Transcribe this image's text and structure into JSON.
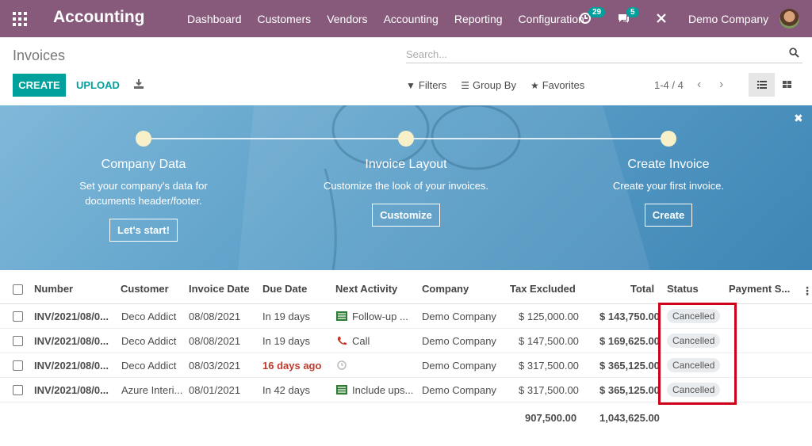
{
  "app": {
    "title": "Accounting"
  },
  "nav": [
    "Dashboard",
    "Customers",
    "Vendors",
    "Accounting",
    "Reporting",
    "Configuration"
  ],
  "systray": {
    "activity_count": "29",
    "messages_count": "5",
    "company": "Demo Company"
  },
  "page": {
    "title": "Invoices"
  },
  "search": {
    "placeholder": "Search..."
  },
  "buttons": {
    "create": "CREATE",
    "upload": "UPLOAD"
  },
  "filters": {
    "filters": "Filters",
    "group_by": "Group By",
    "favorites": "Favorites"
  },
  "pager": {
    "value": "1-4 / 4"
  },
  "banner": {
    "steps": [
      {
        "title": "Company Data",
        "desc1": "Set your company's data for",
        "desc2": "documents header/footer.",
        "button": "Let's start!"
      },
      {
        "title": "Invoice Layout",
        "desc1": "Customize the look of your invoices.",
        "desc2": "",
        "button": "Customize"
      },
      {
        "title": "Create Invoice",
        "desc1": "Create your first invoice.",
        "desc2": "",
        "button": "Create"
      }
    ]
  },
  "table": {
    "columns": [
      "Number",
      "Customer",
      "Invoice Date",
      "Due Date",
      "Next Activity",
      "Company",
      "Tax Excluded",
      "Total",
      "Status",
      "Payment S..."
    ],
    "rows": [
      {
        "number": "INV/2021/08/0...",
        "customer": "Deco Addict",
        "invoice_date": "08/08/2021",
        "due_date": "In 19 days",
        "activity_icon": "list-icon",
        "activity": "Follow-up ...",
        "company": "Demo Company",
        "tax_excluded": "$ 125,000.00",
        "total": "$ 143,750.00",
        "status": "Cancelled"
      },
      {
        "number": "INV/2021/08/0...",
        "customer": "Deco Addict",
        "invoice_date": "08/08/2021",
        "due_date": "In 19 days",
        "activity_icon": "phone-icon",
        "activity": "Call",
        "company": "Demo Company",
        "tax_excluded": "$ 147,500.00",
        "total": "$ 169,625.00",
        "status": "Cancelled"
      },
      {
        "number": "INV/2021/08/0...",
        "customer": "Deco Addict",
        "invoice_date": "08/03/2021",
        "due_date": "16 days ago",
        "activity_icon": "clock-icon",
        "activity": "",
        "company": "Demo Company",
        "tax_excluded": "$ 317,500.00",
        "total": "$ 365,125.00",
        "status": "Cancelled"
      },
      {
        "number": "INV/2021/08/0...",
        "customer": "Azure Interi...",
        "invoice_date": "08/01/2021",
        "due_date": "In 42 days",
        "activity_icon": "list-icon",
        "activity": "Include ups...",
        "company": "Demo Company",
        "tax_excluded": "$ 317,500.00",
        "total": "$ 365,125.00",
        "status": "Cancelled"
      }
    ],
    "totals": {
      "tax_excluded": "907,500.00",
      "total": "1,043,625.00"
    }
  },
  "colors": {
    "topbar": "#875a7b",
    "accent": "#00a09d",
    "overdue": "#c0392b",
    "highlight": "#d0021b"
  }
}
